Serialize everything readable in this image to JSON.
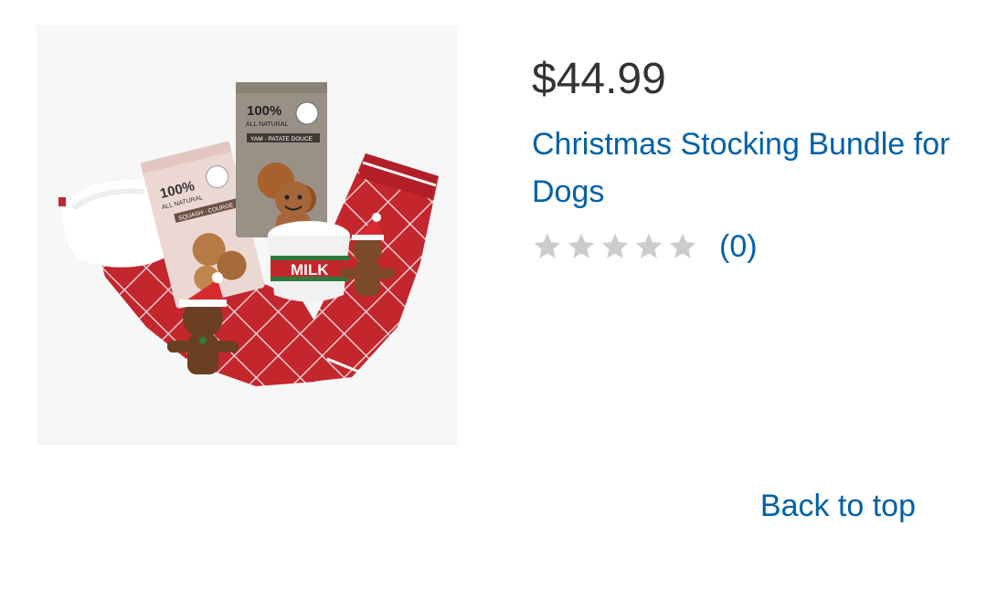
{
  "product": {
    "image_alt": "Christmas Stocking Bundle for Dogs product photo",
    "price": "$44.99",
    "title": "Christmas Stocking Bundle for Dogs",
    "rating": {
      "stars_filled": 0,
      "stars_total": 5,
      "review_count": "(0)"
    },
    "image_labels": {
      "bag_left_pct": "100%",
      "bag_left_sub": "ALL NATURAL",
      "bag_left_flavor": "SQUASH · COURGE",
      "bag_right_pct": "100%",
      "bag_right_sub": "ALL NATURAL",
      "bag_right_flavor": "YAM · PATATE DOUCE",
      "toy_label": "MILK"
    }
  },
  "footer": {
    "back_to_top": "Back to top"
  },
  "colors": {
    "link": "#0060a9",
    "price": "#333333",
    "star_empty": "#cccccc",
    "stocking_red": "#c4262e"
  }
}
